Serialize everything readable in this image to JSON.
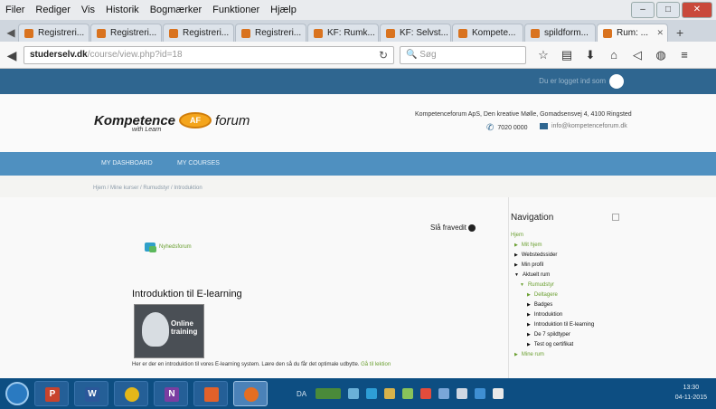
{
  "menu": [
    "Filer",
    "Rediger",
    "Vis",
    "Historik",
    "Bogmærker",
    "Funktioner",
    "Hjælp"
  ],
  "window_controls": {
    "minimize": "–",
    "maximize": "□",
    "close": "✕"
  },
  "tabs": [
    {
      "label": "Registreri..."
    },
    {
      "label": "Registreri..."
    },
    {
      "label": "Registreri..."
    },
    {
      "label": "Registreri..."
    },
    {
      "label": "KF: Rumk..."
    },
    {
      "label": "KF: Selvst..."
    },
    {
      "label": "Kompete..."
    },
    {
      "label": "spildform..."
    },
    {
      "label": "Rum: ...",
      "active": true
    }
  ],
  "tab_new": "+",
  "url": {
    "host": "studerselv.dk",
    "path": "/course/view.php?id=18"
  },
  "search": {
    "placeholder": "Søg"
  },
  "site": {
    "login_text": "Du er logget ind som",
    "logo_left": "Kompetence",
    "logo_mark": "AF",
    "logo_right": "forum",
    "logo_sub": "with Learn",
    "address": "Kompetenceforum ApS, Den kreative Mølle, Gomadsensvej 4, 4100 Ringsted",
    "phone": "7020 0000",
    "email": "info@kompetenceforum.dk"
  },
  "mainnav": [
    "MY DASHBOARD",
    "MY COURSES"
  ],
  "breadcrumb": "Hjem  /  Mine kurser  /  Rumudstyr  /  Introduktion",
  "edit_mode": "Slå fravedit",
  "forum_link": "Nyhedsforum",
  "section_title": "Introduktion til E-learning",
  "course_image_text": "Online\ntraining",
  "intro_text": "Her er der en introduktion til vores E-learning system. Lære den så du får det optimale udbytte.",
  "intro_link": "Gå til lektion",
  "navigation": {
    "title": "Navigation",
    "items": [
      {
        "label": "Hjem",
        "level": 0,
        "link": true
      },
      {
        "label": "Mit hjem",
        "level": 1,
        "link": true
      },
      {
        "label": "Webstedssider",
        "level": 1,
        "link": false
      },
      {
        "label": "Min profil",
        "level": 1,
        "link": false
      },
      {
        "label": "Aktuelt rum",
        "level": 1,
        "link": false
      },
      {
        "label": "Rumudstyr",
        "level": 2,
        "link": true
      },
      {
        "label": "Deltagere",
        "level": 3,
        "link": true
      },
      {
        "label": "Badges",
        "level": 3,
        "link": false
      },
      {
        "label": "Introduktion",
        "level": 3,
        "link": false
      },
      {
        "label": "Introduktion til E-learning",
        "level": 3,
        "link": false
      },
      {
        "label": "De 7 spildtyper",
        "level": 3,
        "link": false
      },
      {
        "label": "Test og certifikat",
        "level": 3,
        "link": false
      },
      {
        "label": "Mine rum",
        "level": 1,
        "link": true
      }
    ]
  },
  "taskbar": {
    "apps": [
      {
        "name": "PowerPoint",
        "glyph": "P",
        "color": "#c8432d"
      },
      {
        "name": "Word",
        "glyph": "W",
        "color": "#2b579a"
      },
      {
        "name": "Chrome",
        "glyph": "",
        "color": "#e3b719"
      },
      {
        "name": "OneNote",
        "glyph": "N",
        "color": "#7a3ea1"
      },
      {
        "name": "Office",
        "glyph": "",
        "color": "#e2612a"
      },
      {
        "name": "Firefox",
        "glyph": "",
        "color": "#e46e22",
        "active": true
      }
    ],
    "lang": "DA",
    "clock_time": "13:30",
    "clock_date": "04-11-2015"
  }
}
